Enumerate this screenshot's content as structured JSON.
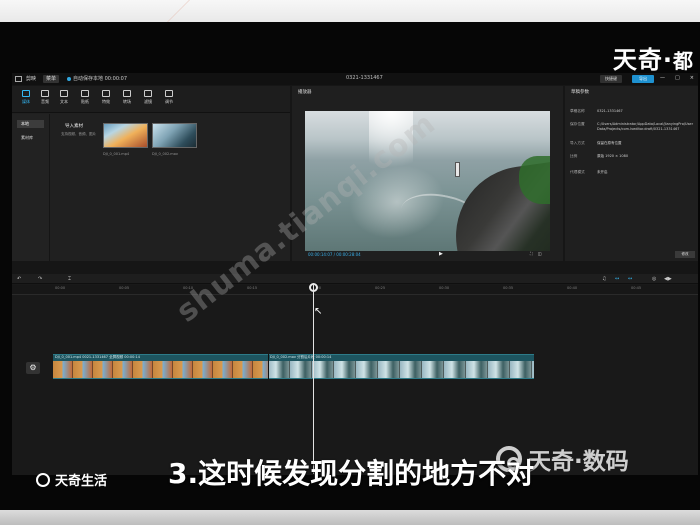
{
  "overlay": {
    "top_brand": "天奇·",
    "top_brand_cut": "都",
    "small_brand": "天奇生活",
    "caption": "3.这时候发现分割的地方不对",
    "watermark": "天奇·数码",
    "diagonal_watermark": "shuma.tianqi.com"
  },
  "app": {
    "logo": "剪映",
    "menu_file": "菜单",
    "status": "自动保存本地 00:00:07",
    "project_title": "0321-1331467",
    "shortcut_label": "快捷键",
    "export_label": "导出",
    "window_controls": [
      "—",
      "□",
      "×"
    ]
  },
  "toolbar": {
    "items": [
      {
        "label": "媒体",
        "icon": "media-icon"
      },
      {
        "label": "音频",
        "icon": "audio-icon"
      },
      {
        "label": "文本",
        "icon": "text-icon"
      },
      {
        "label": "贴纸",
        "icon": "sticker-icon"
      },
      {
        "label": "特效",
        "icon": "effects-icon"
      },
      {
        "label": "转场",
        "icon": "transition-icon"
      },
      {
        "label": "滤镜",
        "icon": "filter-icon"
      },
      {
        "label": "调节",
        "icon": "adjust-icon"
      }
    ]
  },
  "sidebar": {
    "items": [
      {
        "label": "本地"
      },
      {
        "label": "素材库"
      }
    ]
  },
  "media": {
    "import_label": "导入素材",
    "import_hint": "支持视频、音频、图片",
    "clips": [
      {
        "name": "DJI_0_001.mp4"
      },
      {
        "name": "DJI_0_002.mov"
      }
    ]
  },
  "preview": {
    "title": "播放器",
    "timecode": "00:00:14:07 / 00:00:28:04",
    "play_icon": "▶",
    "tools": [
      "⛶",
      "◫"
    ]
  },
  "properties": {
    "title": "草稿参数",
    "rows": [
      {
        "label": "草稿名称",
        "value": "0321-1331467"
      },
      {
        "label": "保存位置",
        "value": "C:/Users/Administrator/AppData/Local/JianyingPro/User Data/Projects/com.lveditor.draft/0321-1331467"
      },
      {
        "label": "导入方式",
        "value": "保留在原有位置"
      },
      {
        "label": "比例",
        "value": "原始 1920 × 1080"
      },
      {
        "label": "代理模式",
        "value": "未开启"
      }
    ],
    "modify_label": "修改"
  },
  "timeline": {
    "tools": [
      "↶",
      "↷",
      "⌶"
    ],
    "right_tools": [
      "♫",
      "↔",
      "↔",
      "◎",
      "◀▶"
    ],
    "ruler": [
      "00:00",
      "00:05",
      "00:10",
      "00:15",
      "00:20",
      "00:25",
      "00:30",
      "00:35",
      "00:40",
      "00:45",
      "00:50",
      "00:55"
    ],
    "clip_a_name": "DJI_0_001.mp4  0021-1331467 全屏视频 00:00:14",
    "clip_b_name": "DJI_0_002.mov  分割后片段 00:00:14"
  }
}
